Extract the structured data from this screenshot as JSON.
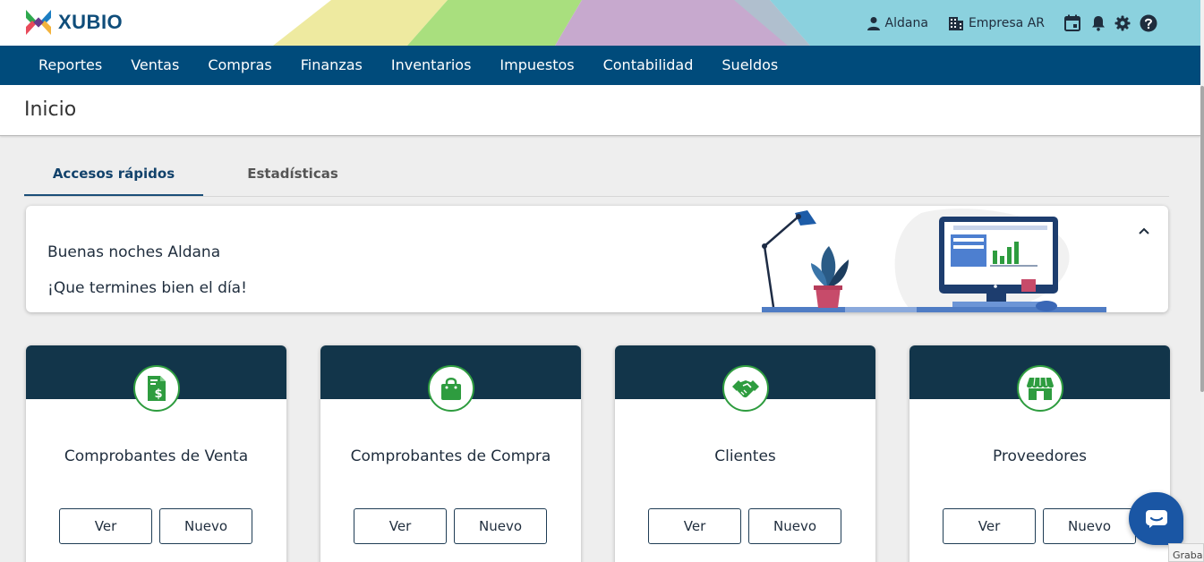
{
  "app": {
    "logo_text": "XUBIO"
  },
  "header": {
    "user_name": "Aldana",
    "company_name": "Empresa AR",
    "colors": {
      "brand_blue": "#004b7b",
      "logo_blue": "#0f4d7a"
    }
  },
  "nav": {
    "items": [
      {
        "label": "Reportes"
      },
      {
        "label": "Ventas"
      },
      {
        "label": "Compras"
      },
      {
        "label": "Finanzas"
      },
      {
        "label": "Inventarios"
      },
      {
        "label": "Impuestos"
      },
      {
        "label": "Contabilidad"
      },
      {
        "label": "Sueldos"
      }
    ]
  },
  "page": {
    "title": "Inicio"
  },
  "tabs": {
    "items": [
      {
        "label": "Accesos rápidos",
        "active": true
      },
      {
        "label": "Estadísticas",
        "active": false
      }
    ]
  },
  "welcome": {
    "greeting": "Buenas noches Aldana",
    "message": "¡Que termines bien el día!"
  },
  "cards": [
    {
      "title": "Comprobantes de Venta",
      "icon": "invoice-icon",
      "ver_label": "Ver",
      "nuevo_label": "Nuevo"
    },
    {
      "title": "Comprobantes de Compra",
      "icon": "shopping-bag-icon",
      "ver_label": "Ver",
      "nuevo_label": "Nuevo"
    },
    {
      "title": "Clientes",
      "icon": "handshake-icon",
      "ver_label": "Ver",
      "nuevo_label": "Nuevo"
    },
    {
      "title": "Proveedores",
      "icon": "store-icon",
      "ver_label": "Ver",
      "nuevo_label": "Nuevo"
    }
  ],
  "footer": {
    "record_label": "Grabar"
  }
}
